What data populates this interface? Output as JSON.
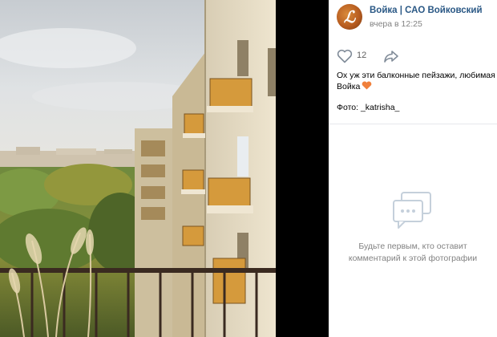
{
  "post": {
    "author": "Войка | САО Войковский",
    "time": "вчера в 12:25",
    "likes": "12",
    "caption": "Ох уж эти балконные пейзажи, любимая Войка",
    "credit": "Фото: _katrisha_"
  },
  "comments": {
    "empty_text": "Будьте первым, кто оставит комментарий к этой фотографии"
  },
  "icons": {
    "like": "heart-outline-icon",
    "share": "share-arrow-icon",
    "caption_emoji": "orange-heart-icon",
    "comments_empty": "speech-bubble-icon"
  },
  "colors": {
    "link": "#2a5885",
    "muted": "#828282",
    "emoji_heart": "#f0803c"
  }
}
